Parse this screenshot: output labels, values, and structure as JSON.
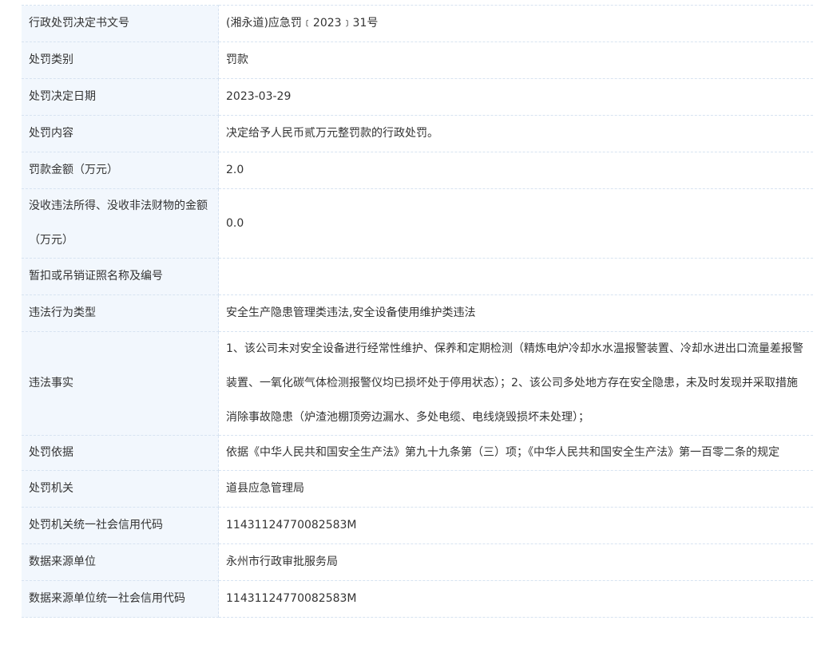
{
  "rows": [
    {
      "label": "行政处罚决定书文号",
      "value": "(湘永道)应急罚﹝2023﹞31号"
    },
    {
      "label": "处罚类别",
      "value": "罚款"
    },
    {
      "label": "处罚决定日期",
      "value": "2023-03-29"
    },
    {
      "label": "处罚内容",
      "value": "决定给予人民币贰万元整罚款的行政处罚。"
    },
    {
      "label": "罚款金额（万元）",
      "value": "2.0"
    },
    {
      "label": "没收违法所得、没收非法财物的金额（万元）",
      "value": "0.0"
    },
    {
      "label": "暂扣或吊销证照名称及编号",
      "value": ""
    },
    {
      "label": "违法行为类型",
      "value": "安全生产隐患管理类违法,安全设备使用维护类违法"
    },
    {
      "label": "违法事实",
      "value": "1、该公司未对安全设备进行经常性维护、保养和定期检测（精炼电炉冷却水水温报警装置、冷却水进出口流量差报警装置、一氧化碳气体检测报警仪均已损坏处于停用状态）；2、该公司多处地方存在安全隐患，未及时发现并采取措施消除事故隐患（炉渣池棚顶旁边漏水、多处电缆、电线烧毁损坏未处理）；"
    },
    {
      "label": "处罚依据",
      "value": "依据《中华人民共和国安全生产法》第九十九条第（三）项；《中华人民共和国安全生产法》第一百零二条的规定"
    },
    {
      "label": "处罚机关",
      "value": "道县应急管理局"
    },
    {
      "label": "处罚机关统一社会信用代码",
      "value": "1143112477008258​3M"
    },
    {
      "label": "数据来源单位",
      "value": "永州市行政审批服务局"
    },
    {
      "label": "数据来源单位统一社会信用代码",
      "value": "1143112477008258​3M"
    }
  ]
}
